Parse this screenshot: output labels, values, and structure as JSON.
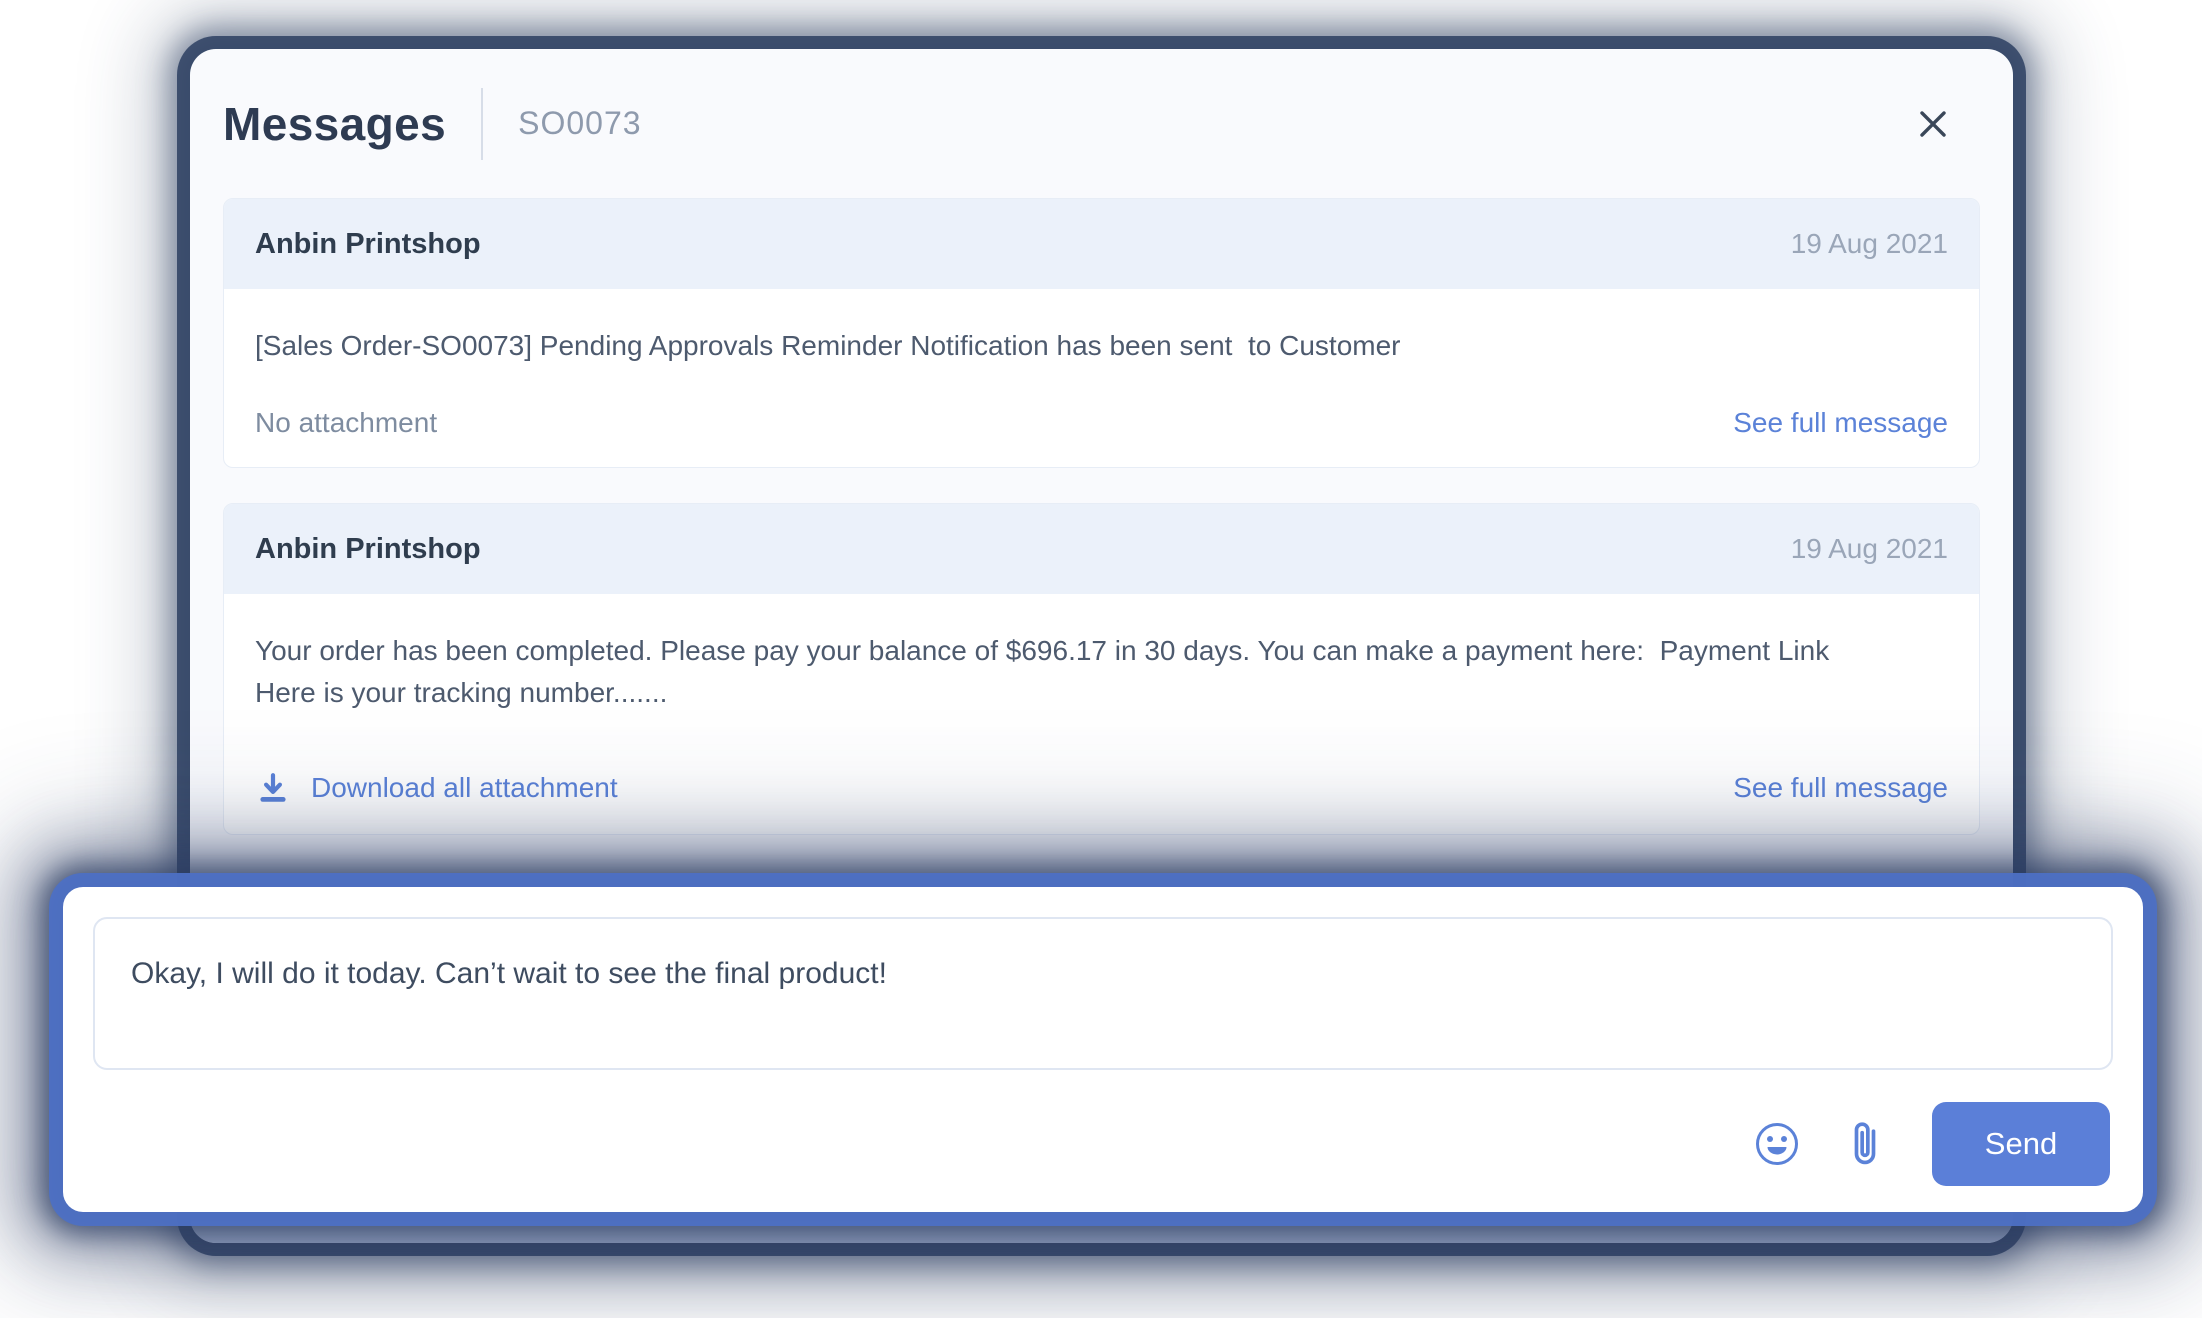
{
  "modal": {
    "title": "Messages",
    "order_id": "SO0073",
    "close_icon": "close-icon"
  },
  "messages": [
    {
      "sender": "Anbin Printshop",
      "date": "19 Aug 2021",
      "body": "[Sales Order-SO0073] Pending Approvals Reminder Notification has been sent  to Customer",
      "attachment_label": "No attachment",
      "see_full_label": "See full message"
    },
    {
      "sender": "Anbin Printshop",
      "date": "19 Aug 2021",
      "body": "Your order has been completed. Please pay your balance of $696.17 in 30 days. You can make a payment here:  Payment Link\nHere is your tracking number.......",
      "attachment_label": "Download all attachment",
      "see_full_label": "See full message",
      "download_icon": "download-icon"
    }
  ],
  "compose": {
    "message_value": "Okay, I will do it today. Can’t wait to see the final product!",
    "send_label": "Send",
    "icons": [
      "emoji-icon",
      "paperclip-icon"
    ]
  },
  "colors": {
    "accent_blue": "#5b82d8",
    "send_button_bg": "#5b7fd8",
    "card_header_bg": "#ebf1fa",
    "modal_bg": "#f9fafd",
    "glow_ring": "#4d70c4",
    "glow_dark": "#2d3f61",
    "title_text": "#2e3b52",
    "body_text": "#4d5a6e",
    "muted_text": "#8e9aad"
  }
}
